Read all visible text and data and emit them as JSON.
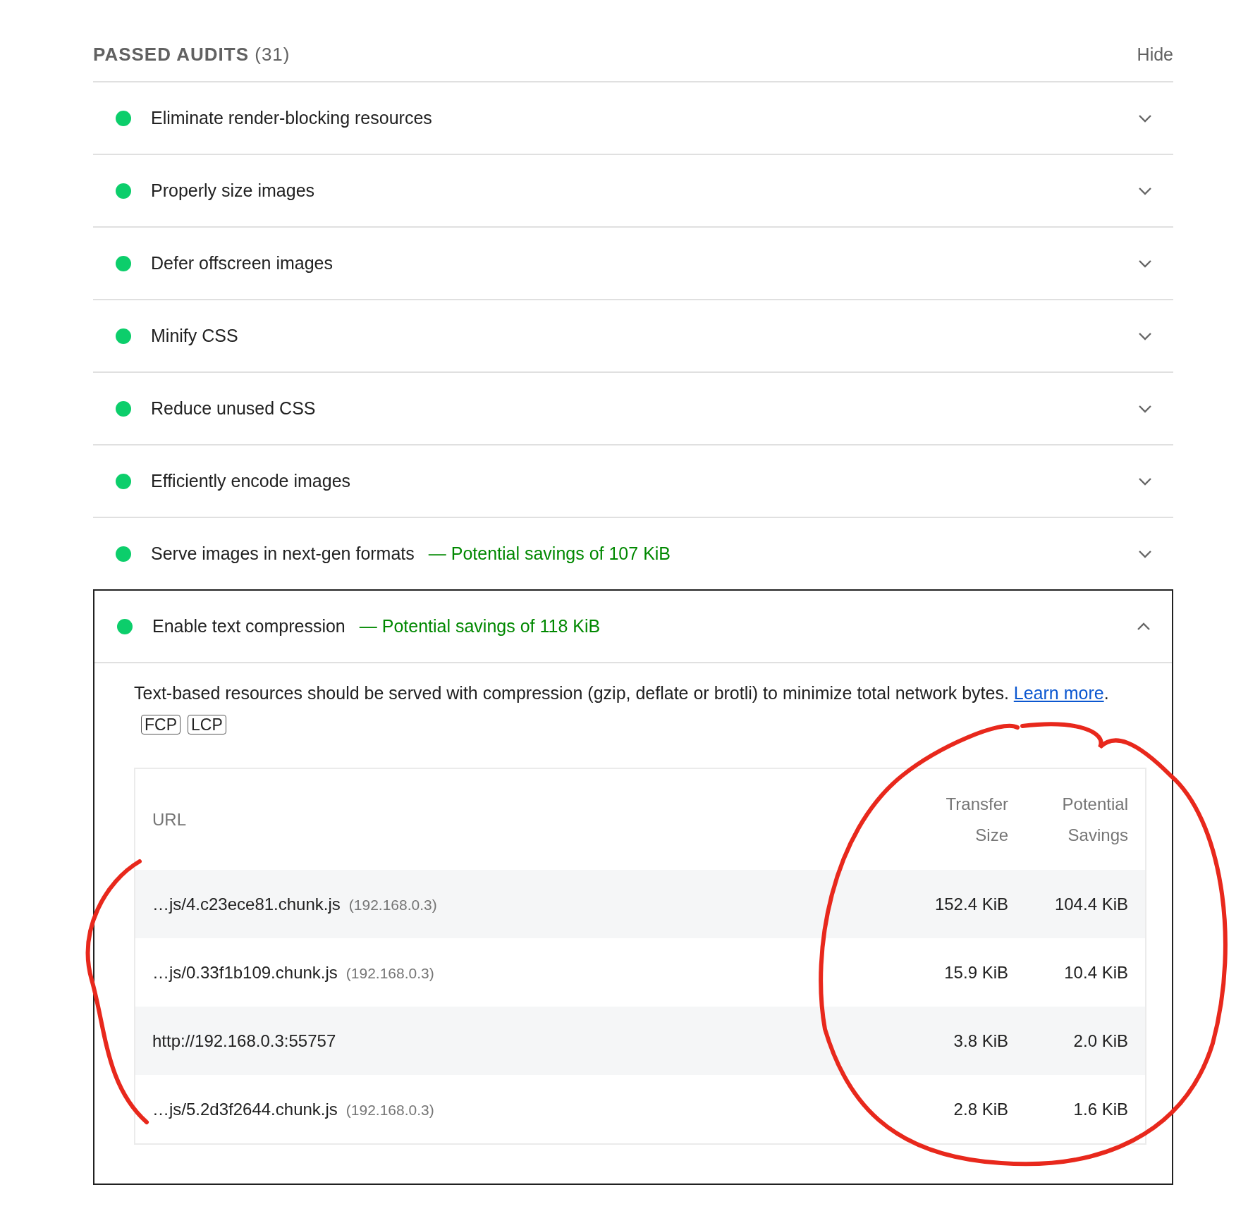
{
  "section": {
    "title": "PASSED AUDITS",
    "count": "(31)",
    "toggle": "Hide"
  },
  "audits": [
    {
      "title": "Eliminate render-blocking resources",
      "expanded": false
    },
    {
      "title": "Properly size images",
      "expanded": false
    },
    {
      "title": "Defer offscreen images",
      "expanded": false
    },
    {
      "title": "Minify CSS",
      "expanded": false
    },
    {
      "title": "Reduce unused CSS",
      "expanded": false
    },
    {
      "title": "Efficiently encode images",
      "expanded": false
    },
    {
      "title": "Serve images in next-gen formats",
      "savings": "— Potential savings of 107 KiB",
      "expanded": false
    },
    {
      "title": "Enable text compression",
      "savings": "— Potential savings of 118 KiB",
      "expanded": true,
      "description": "Text-based resources should be served with compression (gzip, deflate or brotli) to minimize total network bytes.",
      "link": "Learn more",
      "link_after": ".",
      "tags": [
        "FCP",
        "LCP"
      ],
      "table": {
        "columns": [
          "URL",
          "Transfer Size",
          "Potential Savings"
        ],
        "rows": [
          {
            "url": "…js/4.c23ece81.chunk.js",
            "host": "(192.168.0.3)",
            "transfer": "152.4 KiB",
            "savings": "104.4 KiB"
          },
          {
            "url": "…js/0.33f1b109.chunk.js",
            "host": "(192.168.0.3)",
            "transfer": "15.9 KiB",
            "savings": "10.4 KiB"
          },
          {
            "url": "http://192.168.0.3:55757",
            "transfer": "3.8 KiB",
            "savings": "2.0 KiB"
          },
          {
            "url": "…js/5.2d3f2644.chunk.js",
            "host": "(192.168.0.3)",
            "transfer": "2.8 KiB",
            "savings": "1.6 KiB"
          }
        ]
      }
    }
  ]
}
